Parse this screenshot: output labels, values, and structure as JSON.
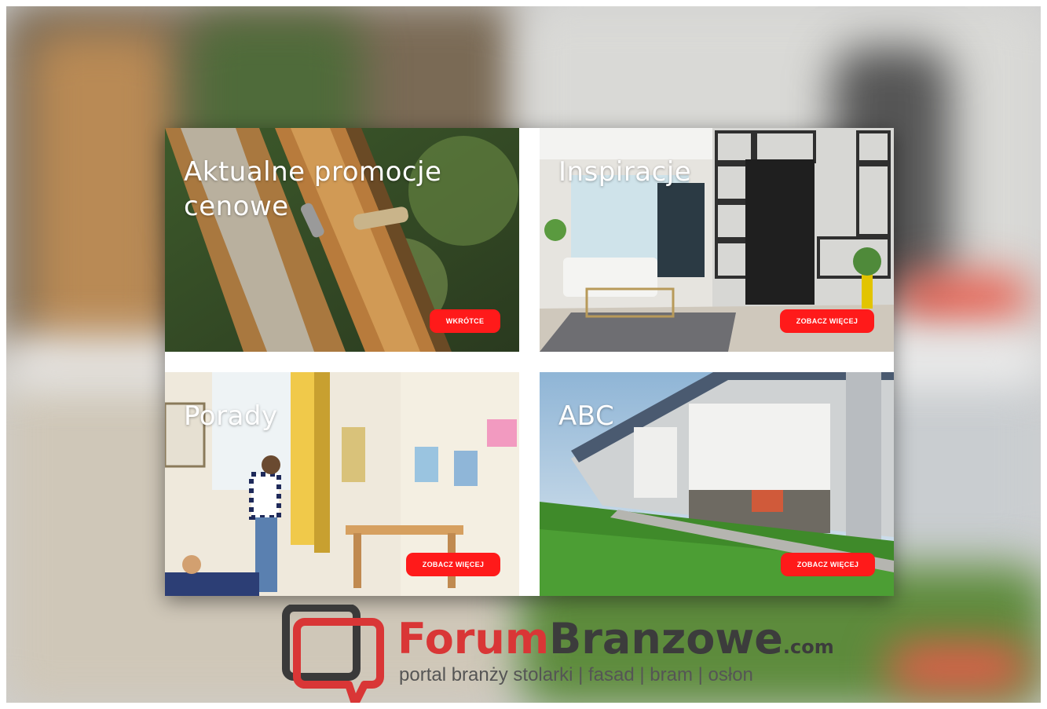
{
  "tiles": [
    {
      "title_line1": "Aktualne promocje",
      "title_line2": "cenowe",
      "button": "WKRÓTCE"
    },
    {
      "title_line1": "Inspiracje",
      "button": "ZOBACZ WIĘCEJ"
    },
    {
      "title_line1": "Porady",
      "button": "ZOBACZ WIĘCEJ"
    },
    {
      "title_line1": "ABC",
      "button": "ZOBACZ WIĘCEJ"
    }
  ],
  "logo": {
    "forum": "Forum",
    "branzowe": "Branzowe",
    "com": ".com",
    "tagline": "portal branży stolarki | fasad | bram | osłon"
  },
  "colors": {
    "button": "#ff1a1a",
    "brand_red": "#d93636",
    "brand_dark": "#3c3c3c"
  }
}
